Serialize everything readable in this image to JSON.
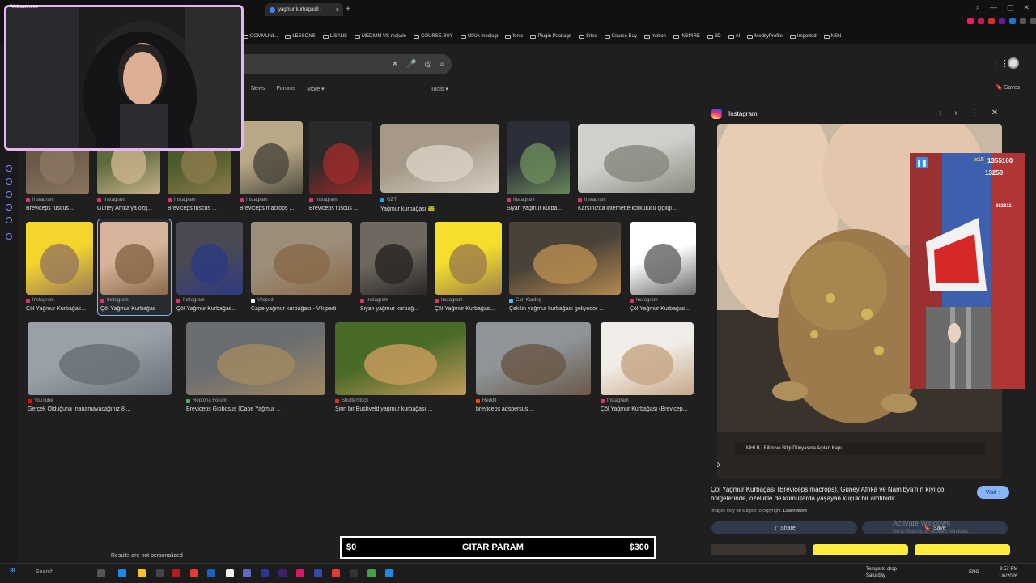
{
  "webcam": {
    "label": "Webcam.exe"
  },
  "browser": {
    "tab_title": "yagmur kurbagas8 - ",
    "bookmarks": [
      "COMMUNI...",
      "LESSONS",
      "LİSANS",
      "MEDIUM VS makale",
      "COURSE BUY",
      "UI/Ux mockup",
      "fonts",
      "Plugin Package",
      "Sites",
      "Course Buy",
      "motion",
      "INSPIRE",
      "3D",
      "AI",
      "ModifyProfile",
      "Imported",
      "NSN"
    ]
  },
  "search": {
    "filters": [
      "News",
      "Forums",
      "More"
    ],
    "tools": "Tools",
    "saves": "Saves"
  },
  "results": [
    {
      "source": "Instagram",
      "title": "Breviceps fuscus ...",
      "src_color": "#e1306c"
    },
    {
      "source": "Instagram",
      "title": "Güney Afrika'ya özg...",
      "src_color": "#e1306c"
    },
    {
      "source": "Instagram",
      "title": "Breviceps fuscus ...",
      "src_color": "#e1306c"
    },
    {
      "source": "Instagram",
      "title": "Breviceps macrops ...",
      "src_color": "#e1306c"
    },
    {
      "source": "Instagram",
      "title": "Breviceps fuscus ...",
      "src_color": "#e1306c"
    },
    {
      "source": "GZT",
      "title": "Yağmur kurbağası 🐸",
      "src_color": "#1da1f2"
    },
    {
      "source": "Instagram",
      "title": "Siyah yağmur kurba...",
      "src_color": "#e1306c"
    },
    {
      "source": "Instagram",
      "title": "Karşınızda internette korkulucu çiğliği ...",
      "src_color": "#e1306c"
    },
    {
      "source": "Instagram",
      "title": "Çöl Yağmur Kurbağas...",
      "src_color": "#e1306c"
    },
    {
      "source": "Instagram",
      "title": "Çöl Yağmur Kurbağas",
      "src_color": "#e1306c"
    },
    {
      "source": "Instagram",
      "title": "Çöl Yağmur Kurbağas...",
      "src_color": "#e1306c"
    },
    {
      "source": "Vikipedi",
      "title": "Cape yağmur kurbağası - Vikipedi",
      "src_color": "#ffffff"
    },
    {
      "source": "Instagram",
      "title": "Siyah yağmur kurbağ...",
      "src_color": "#e1306c"
    },
    {
      "source": "Instagram",
      "title": "Çöl Yağmur Kurbağas...",
      "src_color": "#e1306c"
    },
    {
      "source": "Can Kardeş",
      "title": "Çekilin yağmur kurbağası geliyooor ...",
      "src_color": "#4fc3f7"
    },
    {
      "source": "Instagram",
      "title": "Çöl Yağmur Kurbağas...",
      "src_color": "#e1306c"
    },
    {
      "source": "YouTube",
      "title": "Gerçek Olduğuna İnanamayacağınız 8 ...",
      "src_color": "#ff0000"
    },
    {
      "source": "Reptoria Forum",
      "title": "Breviceps Gibbosus (Cape Yağmur ...",
      "src_color": "#4caf50"
    },
    {
      "source": "Shutterstock",
      "title": "Şirin bir Bushveld yağmur kurbağası ...",
      "src_color": "#ee2b24"
    },
    {
      "source": "Reddit",
      "title": "breviceps adspersus ...",
      "src_color": "#ff4500"
    },
    {
      "source": "Instagram",
      "title": "Çöl Yağmur Kurbağası (Brevicep...",
      "src_color": "#e1306c"
    }
  ],
  "not_personalized": "Results are not personalized",
  "panel": {
    "source": "Instagram",
    "description": "Çöl Yağmur Kurbağası (Breviceps macrops), Güney Afrika ve Namibya'nın kıyı çöl bölgelerinde, özellikle de kumullarda yaşayan küçük bir amfibidir....",
    "copyright": "Images may be subject to copyright.",
    "learn_more": "Learn More",
    "visit": "Visit",
    "share": "Share",
    "save": "Save",
    "video_caption": "MHLB | Bilim ve Bilgi Dünyasına Açılan Kapı"
  },
  "windows_notice": {
    "title": "Activate Windows",
    "sub": "Go to Settings to activate Windows."
  },
  "game": {
    "multiplier": "x15",
    "score": "1355160",
    "coins": "13250",
    "hiscore": "382811"
  },
  "gitar": {
    "left": "$0",
    "title": "GITAR PARAM",
    "right": "$300"
  },
  "taskbar": {
    "search": "Search",
    "weather_line1": "Temps to drop",
    "weather_line2": "Saturday",
    "lang": "ENG",
    "time": "9:57 PM",
    "date": "1/6/2026"
  }
}
